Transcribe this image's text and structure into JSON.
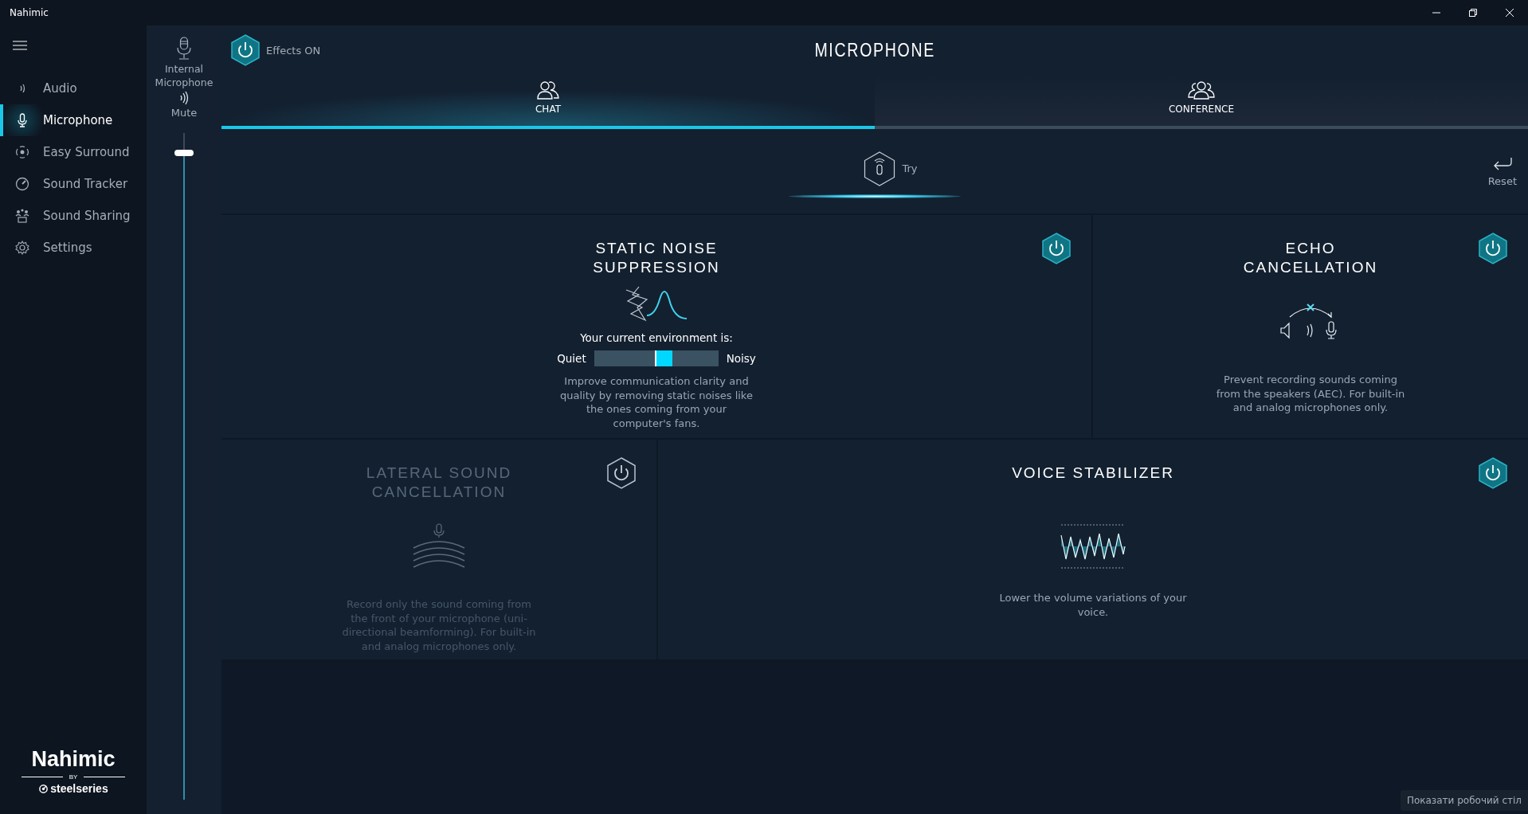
{
  "window": {
    "title": "Nahimic"
  },
  "sidebar": {
    "items": [
      {
        "label": "Audio",
        "kind": "audio",
        "selected": false
      },
      {
        "label": "Microphone",
        "kind": "microphone",
        "selected": true
      },
      {
        "label": "Easy Surround",
        "kind": "surround",
        "selected": false
      },
      {
        "label": "Sound Tracker",
        "kind": "tracker",
        "selected": false
      },
      {
        "label": "Sound Sharing",
        "kind": "sharing",
        "selected": false
      },
      {
        "label": "Settings",
        "kind": "settings",
        "selected": false
      }
    ]
  },
  "device": {
    "name": "Internal Microphone",
    "mute_label": "Mute",
    "level": 0.97
  },
  "header": {
    "effects": {
      "label": "Effects ON",
      "on": true
    },
    "title": "MICROPHONE"
  },
  "tabs": [
    {
      "label": "CHAT",
      "kind": "chat",
      "selected": true
    },
    {
      "label": "CONFERENCE",
      "kind": "conference",
      "selected": false
    }
  ],
  "try": {
    "label": "Try"
  },
  "reset": {
    "label": "Reset"
  },
  "cards": [
    {
      "kind": "noise",
      "title": "STATIC NOISE\nSUPPRESSION",
      "on": true,
      "meter": {
        "caption": "Your current environment is:",
        "low": "Quiet",
        "high": "Noisy",
        "level": 0.56
      },
      "description": "Improve communication clarity and quality by removing static noises like the ones coming from your computer's fans."
    },
    {
      "kind": "echo",
      "title": "ECHO\nCANCELLATION",
      "on": true,
      "description": "Prevent recording sounds coming from the speakers (AEC). For built-in and analog microphones only."
    },
    {
      "kind": "lateral",
      "title": "LATERAL SOUND\nCANCELLATION",
      "on": false,
      "description": "Record only the sound coming from the front of your microphone (uni-directional beamforming). For built-in and analog microphones only."
    },
    {
      "kind": "stabilizer",
      "title": "VOICE STABILIZER",
      "on": true,
      "description": "Lower the volume variations of your voice."
    }
  ],
  "logo": {
    "brand": "Nahimic",
    "by": "BY",
    "partner": "steelseries"
  },
  "tooltip": "Показати робочий стіл"
}
